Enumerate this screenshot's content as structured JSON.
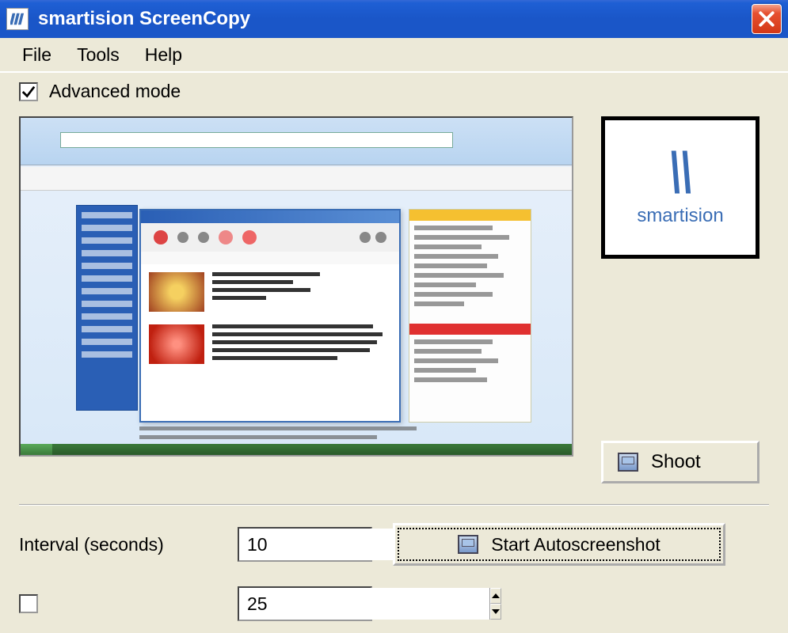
{
  "window": {
    "title": "smartision ScreenCopy"
  },
  "menu": {
    "file": "File",
    "tools": "Tools",
    "help": "Help"
  },
  "advanced": {
    "label": "Advanced mode",
    "checked": true
  },
  "logo": {
    "brand": "smartision"
  },
  "buttons": {
    "shoot": "Shoot",
    "autoscreenshot": "Start Autoscreenshot"
  },
  "interval": {
    "label": "Interval (seconds)",
    "value": "10"
  },
  "limit": {
    "value": "25"
  }
}
